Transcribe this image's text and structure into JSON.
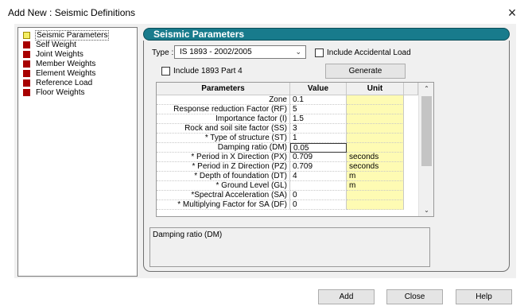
{
  "window": {
    "title": "Add New : Seismic Definitions",
    "close_glyph": "×"
  },
  "tree": {
    "items": [
      {
        "label": "Seismic Parameters",
        "icon": "yellow-doc-icon",
        "selected": true
      },
      {
        "label": "Self Weight",
        "icon": "red-doc-icon"
      },
      {
        "label": "Joint Weights",
        "icon": "red-doc-icon"
      },
      {
        "label": "Member Weights",
        "icon": "red-doc-icon"
      },
      {
        "label": "Element Weights",
        "icon": "red-doc-icon"
      },
      {
        "label": "Reference Load",
        "icon": "red-doc-icon"
      },
      {
        "label": "Floor Weights",
        "icon": "red-doc-icon"
      }
    ]
  },
  "panel": {
    "title": "Seismic Parameters",
    "type_label": "Type :",
    "type_value": "IS 1893 - 2002/2005",
    "include_accidental": "Include Accidental Load",
    "include_part4": "Include 1893 Part 4",
    "generate_label": "Generate"
  },
  "grid": {
    "headers": {
      "param": "Parameters",
      "value": "Value",
      "unit": "Unit"
    },
    "rows": [
      {
        "param": "Zone",
        "value": "0.1",
        "unit": ""
      },
      {
        "param": "Response reduction Factor (RF)",
        "value": "5",
        "unit": ""
      },
      {
        "param": "Importance factor (I)",
        "value": "1.5",
        "unit": ""
      },
      {
        "param": "Rock and soil site factor (SS)",
        "value": "3",
        "unit": ""
      },
      {
        "param": "* Type of structure (ST)",
        "value": "1",
        "unit": ""
      },
      {
        "param": "Damping ratio (DM)",
        "value": "0.05",
        "unit": ""
      },
      {
        "param": "* Period in X Direction (PX)",
        "value": "0.709",
        "unit": "seconds"
      },
      {
        "param": "* Period in Z Direction (PZ)",
        "value": "0.709",
        "unit": "seconds"
      },
      {
        "param": "* Depth of foundation (DT)",
        "value": "4",
        "unit": "m"
      },
      {
        "param": "* Ground Level (GL)",
        "value": "",
        "unit": "m"
      },
      {
        "param": "*Spectral Acceleration (SA)",
        "value": "0",
        "unit": ""
      },
      {
        "param": "* Multiplying Factor for SA (DF)",
        "value": "0",
        "unit": ""
      }
    ]
  },
  "description": "Damping ratio (DM)",
  "buttons": {
    "add": "Add",
    "close": "Close",
    "help": "Help"
  },
  "colors": {
    "header_teal": "#187b8c",
    "unit_yellow": "#fefbb3",
    "doc_red": "#a80000"
  }
}
